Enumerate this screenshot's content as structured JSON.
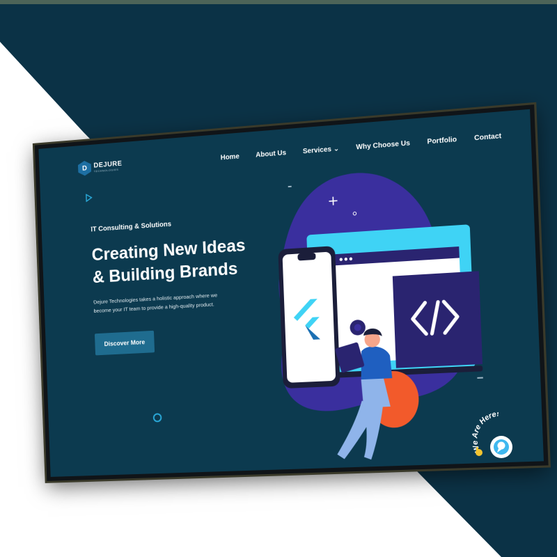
{
  "colors": {
    "page_dark": "#0b3246",
    "screen_bg": "#0c3a4f",
    "accent_blue": "#1f6c8f",
    "blob_purple": "#3a2f9e",
    "cyan": "#3fd3f5"
  },
  "brand": {
    "logo_letter": "D",
    "name": "DEJURE",
    "tagline": "TECHNOLOGIES"
  },
  "nav": {
    "items": [
      {
        "label": "Home"
      },
      {
        "label": "About Us"
      },
      {
        "label": "Services ⌄"
      },
      {
        "label": "Why Choose Us"
      },
      {
        "label": "Portfolio"
      },
      {
        "label": "Contact"
      }
    ]
  },
  "hero": {
    "eyebrow": "IT Consulting & Solutions",
    "headline_line1": "Creating New Ideas",
    "headline_line2": "& Building Brands",
    "description": "Dejure Technologies takes a holistic approach where we become your IT team to provide a high-quality product.",
    "cta_label": "Discover More"
  },
  "illustration": {
    "code_symbol": "</>",
    "icons": [
      "flutter-logo-icon",
      "code-brackets-icon",
      "gear-icon",
      "laptop-icon"
    ]
  },
  "chat": {
    "badge_text": "We Are Here!",
    "icons": [
      "waving-hand-icon",
      "chat-bubble-icon"
    ]
  }
}
